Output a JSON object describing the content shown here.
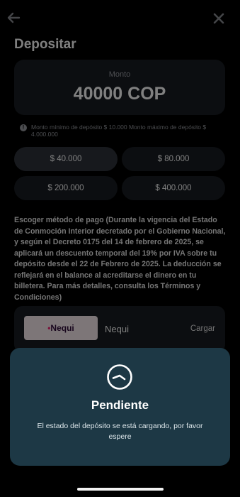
{
  "header": {
    "title": "Depositar"
  },
  "amount": {
    "label": "Monto",
    "value": "40000 COP"
  },
  "limits": {
    "text": "Monto mínimo de depósito $ 10.000 Monto máximo de depósito $ 4.000.000"
  },
  "quick_amounts": [
    {
      "label": "$ 40.000",
      "selected": true
    },
    {
      "label": "$ 80.000",
      "selected": false
    },
    {
      "label": "$ 200.000",
      "selected": false
    },
    {
      "label": "$ 400.000",
      "selected": false
    }
  ],
  "payment_method": {
    "heading": "Escoger método de pago (Durante la vigencia del Estado de Conmoción Interior decretado por el Gobierno Nacional, y según el Decreto 0175 del 14 de febrero de 2025, se aplicará un descuento temporal del 19% por IVA sobre tu depósito desde el 22 de Febrero de 2025. La deducción se reflejará en el balance al acreditarse el dinero en tu billetera. Para más detalles, consulta los Términos y Condiciones)",
    "options": [
      {
        "logo_text": "Nequi",
        "name": "Nequi",
        "action": "Cargar"
      }
    ]
  },
  "modal": {
    "title": "Pendiente",
    "message": "El estado del depósito se está cargando, por favor espere",
    "icon": "clock-icon"
  },
  "colors": {
    "background": "#000000",
    "card": "#171a1f",
    "modal": "#1d3845",
    "nequi_brand": "#e0206a"
  }
}
